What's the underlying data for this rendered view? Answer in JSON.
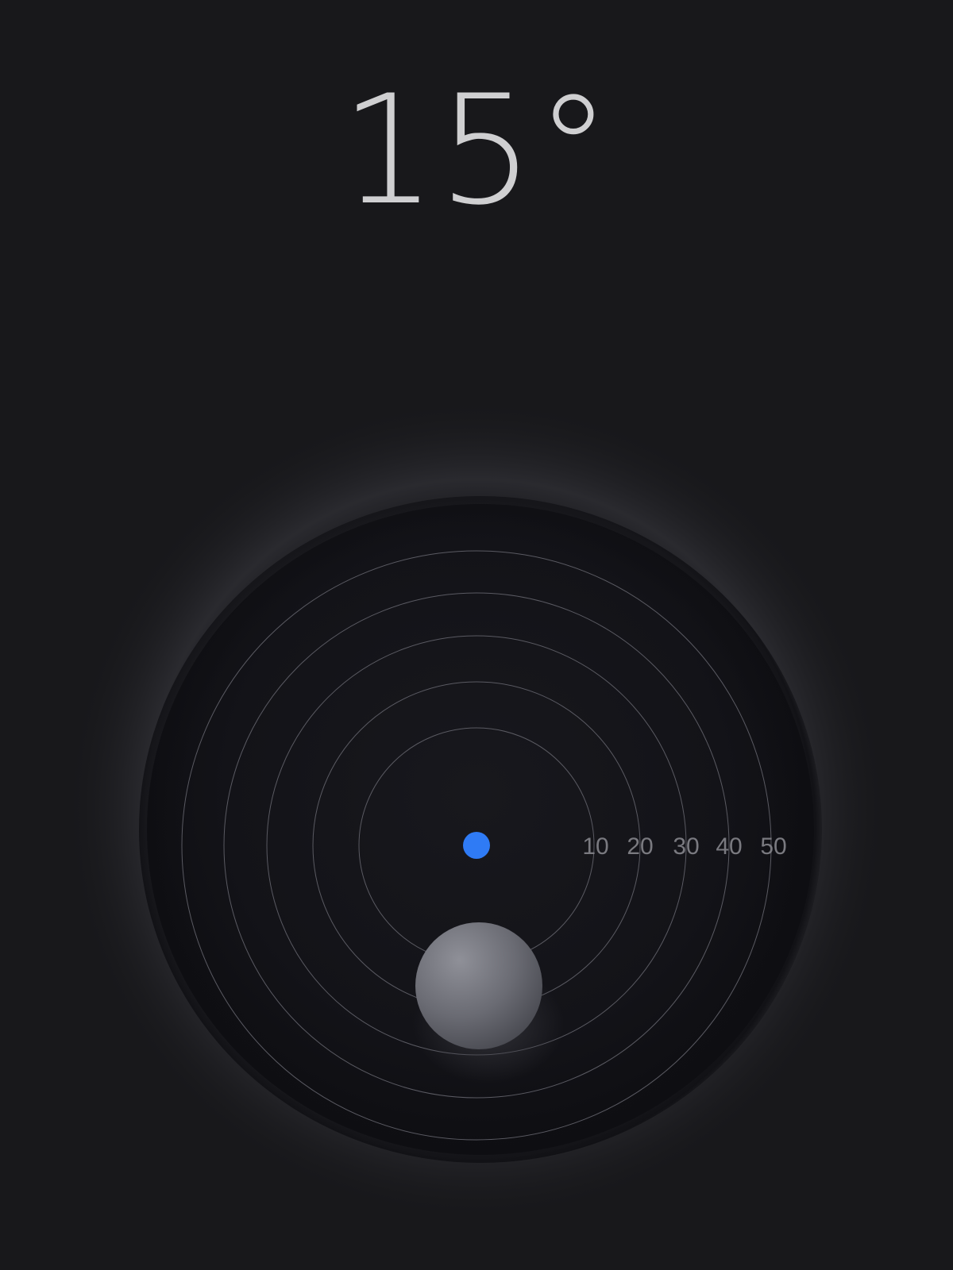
{
  "level": {
    "angle_text": "15°",
    "scale_labels": [
      "10",
      "20",
      "30",
      "40",
      "50"
    ]
  },
  "colors": {
    "background": "#18181b",
    "bowl": "#131318",
    "ring_stroke": "#5a5a62",
    "center_dot": "#2f7bf5",
    "bubble_light": "#8f9098",
    "bubble_dark": "#45464d"
  },
  "icons": {
    "center": "target-dot-icon",
    "bubble": "level-bubble-icon"
  }
}
